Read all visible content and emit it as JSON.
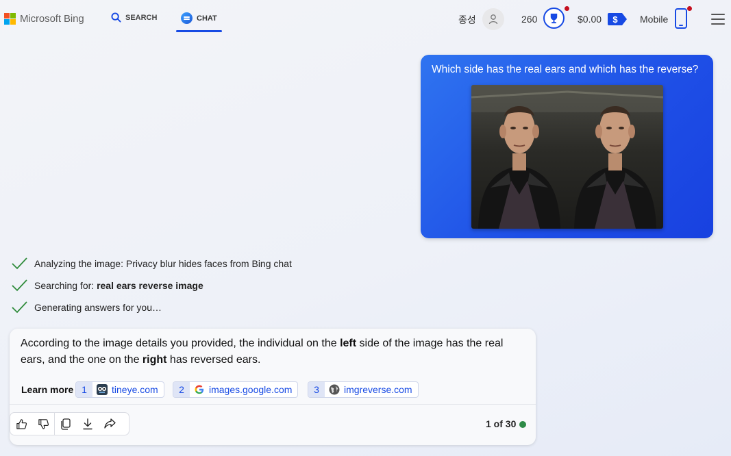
{
  "header": {
    "logo_text": "Microsoft Bing",
    "tabs": [
      {
        "label": "SEARCH",
        "active": false
      },
      {
        "label": "CHAT",
        "active": true
      }
    ],
    "user_name": "종성",
    "points": "260",
    "balance": "$0.00",
    "mobile_label": "Mobile",
    "accent_color": "#174ae4",
    "notification_color": "#c50f1f"
  },
  "conversation": {
    "user_message": {
      "text": "Which side has the real ears and which has the reverse?",
      "image_alt": "Two side-by-side copies of a photo of a man in a black leather jacket"
    },
    "steps": [
      {
        "prefix": "Analyzing the image: Privacy blur hides faces from Bing chat",
        "bold": ""
      },
      {
        "prefix": "Searching for: ",
        "bold": "real ears reverse image"
      },
      {
        "prefix": "Generating answers for you…",
        "bold": ""
      }
    ],
    "bot_response": {
      "part1": "According to the image details you provided, the individual on the ",
      "bold1": "left",
      "part2": " side of the image has the real ears, and the one on the ",
      "bold2": "right",
      "part3": " has reversed ears.",
      "learn_more_label": "Learn more",
      "sources": [
        {
          "num": "1",
          "name": "tineye.com",
          "icon": "tineye-icon"
        },
        {
          "num": "2",
          "name": "images.google.com",
          "icon": "google-icon"
        },
        {
          "num": "3",
          "name": "imgreverse.com",
          "icon": "globe-icon"
        }
      ],
      "counter": "1 of 30",
      "status_color": "#2e8b47"
    }
  }
}
